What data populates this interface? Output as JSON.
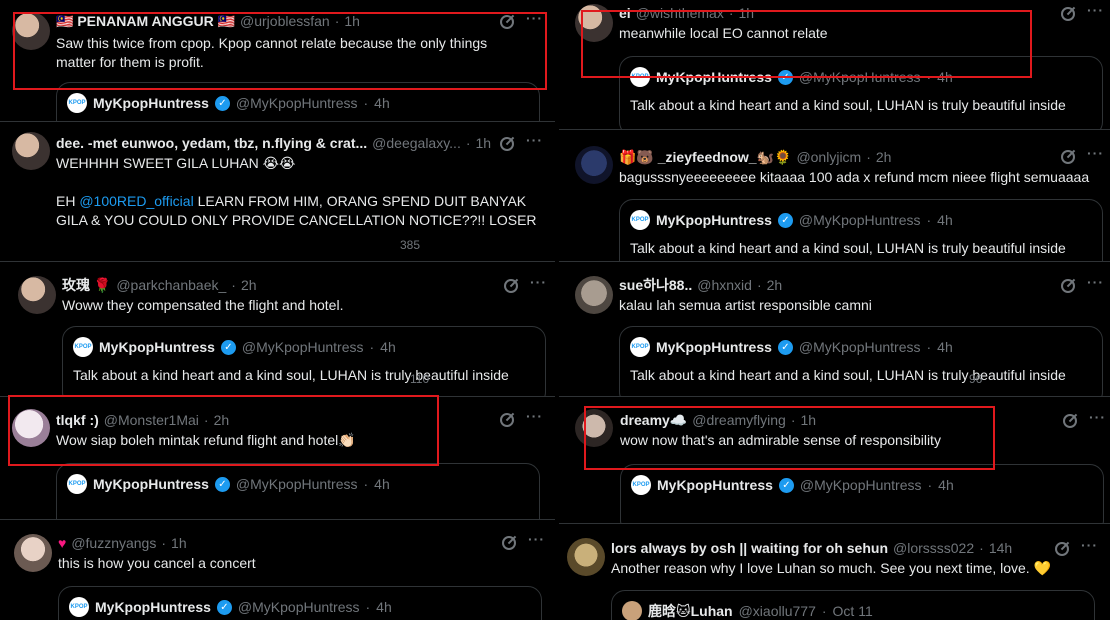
{
  "quoted": {
    "name": "MyKpopHuntress",
    "handle": "@MyKpopHuntress",
    "time": "4h",
    "text": "Talk about a kind heart and a kind soul, LUHAN is truly beautiful inside",
    "avatar_text": "KPOP"
  },
  "luhan_quote": {
    "name": "鹿晗🐱Luhan",
    "handle": "@xiaollu777",
    "time": "Oct 11"
  },
  "tweets": [
    {
      "name": "🇲🇾 PENANAM ANGGUR 🇲🇾",
      "handle": "@urjoblessfan",
      "time": "1h",
      "line1": "Saw this twice from cpop. Kpop cannot relate because the only things",
      "line2": "matter for them is profit."
    },
    {
      "name": "dee. -met eunwoo, yedam, tbz, n.flying & crat...",
      "handle": "@deegalaxy...",
      "time": "1h",
      "line1": "WEHHHH SWEET GILA LUHAN 😭😭",
      "line2_mention": "@100RED_official",
      "line2": " LEARN FROM HIM, ORANG SPEND DUIT BANYAK",
      "line2_prefix": "EH ",
      "line3": "GILA & YOU COULD ONLY PROVIDE CANCELLATION NOTICE??!! LOSER"
    },
    {
      "name": "玫瑰 🌹",
      "handle": "@parkchanbaek_",
      "time": "2h",
      "line1": "Woww they compensated the flight and hotel."
    },
    {
      "name": "tlqkf :)",
      "handle": "@Monster1Mai",
      "time": "2h",
      "line1": "Wow siap boleh mintak refund flight and hotel👏🏻"
    },
    {
      "name": "♥",
      "handle": "@fuzznyangs",
      "time": "1h",
      "line1": "this is how you cancel a concert"
    },
    {
      "name": "ei",
      "handle": "@wishthemax",
      "time": "1h",
      "line1": "meanwhile local EO cannot relate"
    },
    {
      "name": "🎁🐻 _zieyfeednow_🐿️🌻",
      "handle": "@onlyjicm",
      "time": "2h",
      "line1": "bagusssnyeeeeeeeee kitaaaa 100 ada x refund mcm nieee flight semuaaaa"
    },
    {
      "name": "sue하나88..",
      "handle": "@hxnxid",
      "time": "2h",
      "line1": "kalau lah semua artist responsible camni"
    },
    {
      "name": "dreamy☁️",
      "handle": "@dreamyflying",
      "time": "1h",
      "line1": "wow now that's an admirable sense of responsibility"
    },
    {
      "name": "lors always by osh || waiting for oh sehun",
      "handle": "@lorssss022",
      "time": "14h",
      "line1": "Another reason why I love Luhan so much. See you next time, love. 💛"
    }
  ],
  "dot": "·",
  "more": "···",
  "counts": {
    "c1": "110",
    "c2": "96",
    "c3": "385"
  }
}
